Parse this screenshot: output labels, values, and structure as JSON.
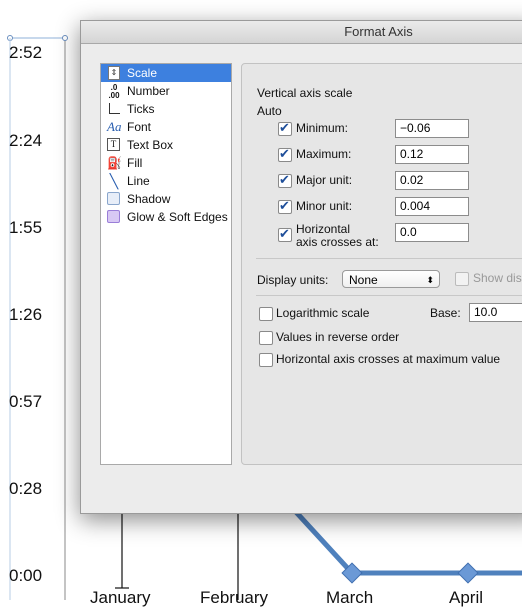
{
  "chart": {
    "y_tick_labels": [
      "2:52",
      "2:24",
      "1:55",
      "1:26",
      "0:57",
      "0:28",
      "0:00"
    ],
    "x_tick_labels": [
      "January",
      "February",
      "March",
      "April"
    ],
    "line_color": "#4f81bd"
  },
  "dialog": {
    "title": "Format Axis",
    "sidebar": {
      "items": [
        {
          "label": "Scale",
          "icon": "scale-icon",
          "selected": true
        },
        {
          "label": "Number",
          "icon": "number-icon",
          "selected": false
        },
        {
          "label": "Ticks",
          "icon": "ticks-icon",
          "selected": false
        },
        {
          "label": "Font",
          "icon": "font-icon",
          "selected": false
        },
        {
          "label": "Text Box",
          "icon": "text-box-icon",
          "selected": false
        },
        {
          "label": "Fill",
          "icon": "fill-icon",
          "selected": false
        },
        {
          "label": "Line",
          "icon": "line-icon",
          "selected": false
        },
        {
          "label": "Shadow",
          "icon": "shadow-icon",
          "selected": false
        },
        {
          "label": "Glow & Soft Edges",
          "icon": "glow-icon",
          "selected": false
        }
      ]
    },
    "scale": {
      "section_title": "Vertical axis scale",
      "auto_label": "Auto",
      "rows": [
        {
          "label": "Minimum:",
          "value": "−0.06",
          "checked": true
        },
        {
          "label": "Maximum:",
          "value": "0.12",
          "checked": true
        },
        {
          "label": "Major unit:",
          "value": "0.02",
          "checked": true
        },
        {
          "label": "Minor unit:",
          "value": "0.004",
          "checked": true
        },
        {
          "label_line1": "Horizontal",
          "label_line2": "axis crosses at:",
          "value": "0.0",
          "checked": true
        }
      ],
      "display_units_label": "Display units:",
      "display_units_value": "None",
      "show_display_label": "Show disp",
      "log_scale_label": "Logarithmic scale",
      "base_label": "Base:",
      "base_value": "10.0",
      "reverse_label": "Values in reverse order",
      "cross_max_label": "Horizontal axis crosses at maximum value"
    }
  }
}
